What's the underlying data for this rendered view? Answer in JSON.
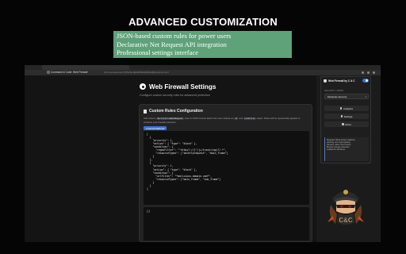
{
  "headline": "ADVANCED CUSTOMIZATION",
  "features": [
    "JSON-based custom rules for power users",
    "Declarative Net Request API integration",
    "Professional settings interface"
  ],
  "browser": {
    "tab_title": "Command & Code: Web Firewall",
    "url": "chrome-extension://dfhmlkmfjkldsfhlkdsfjhklsdfjhl/options.html"
  },
  "page": {
    "title": "Web Firewall Settings",
    "subtitle": "Configure custom security rules for advanced protection",
    "card_title": "Custom Rules Configuration",
    "help_prefix": "Add custom",
    "help_code1": "declarativeNetRequest",
    "help_mid": "rules in JSON format. Each rule must include an",
    "help_code2": "id",
    "help_and": "and",
    "help_code3": "condition",
    "help_suffix": "object. Rules will be dynamically applied to enhance your firewall protection.",
    "example_button": "LOAD EXAMPLES",
    "rules_json": "[\n  {\n    \"priority\": 1,\n    \"action\": { \"type\": \"block\" },\n    \"condition\": {\n      \"regexFilter\": \"^https?://[^/]+/track(ing)?/.*\",\n      \"resourceTypes\": [\"xmlhttprequest\", \"main_frame\"]\n    }\n  },\n  {\n    \"priority\": 1,\n    \"action\": { \"type\": \"block\" },\n    \"condition\": {\n      \"urlFilter\": \"*malicious-domain.com*\",\n      \"resourceTypes\": [\"main_frame\", \"sub_frame\"]\n    }\n  }\n]",
    "second_editor": "[]"
  },
  "extension": {
    "name": "Web Firewall by C & C",
    "section_label": "SECURITY MODE",
    "mode_value": "Moderate Security",
    "buttons": [
      "Analytics",
      "Settings",
      "About"
    ],
    "note_lines": [
      "Moderate: Block known malicious,",
      "phishing, and crypto-jacking",
      "domains; allow most content.",
      "",
      "Browser storage protection",
      "enabled for all frames."
    ]
  },
  "mascot_label": "C&C",
  "colors": {
    "feature_box": "#5fa179",
    "accent_blue": "#3b6fd6",
    "page_bg": "#141414"
  }
}
